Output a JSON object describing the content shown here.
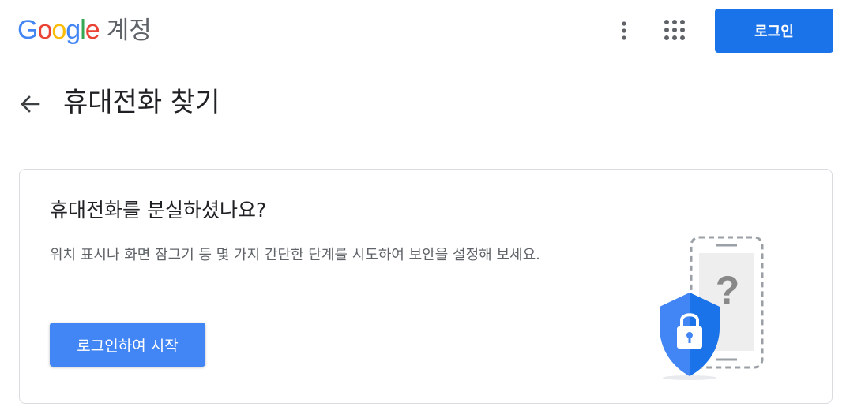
{
  "header": {
    "logo": {
      "letters": [
        {
          "char": "G",
          "color": "#4285F4"
        },
        {
          "char": "o",
          "color": "#EA4335"
        },
        {
          "char": "o",
          "color": "#FBBC05"
        },
        {
          "char": "g",
          "color": "#4285F4"
        },
        {
          "char": "l",
          "color": "#34A853"
        },
        {
          "char": "e",
          "color": "#EA4335"
        }
      ],
      "product": "계정"
    },
    "more_icon": "more-vertical-icon",
    "apps_icon": "apps-grid-icon",
    "signin_label": "로그인"
  },
  "page": {
    "back_icon": "arrow-back-icon",
    "title": "휴대전화 찾기"
  },
  "card": {
    "title": "휴대전화를 분실하셨나요?",
    "description": "위치 표시나 화면 잠그기 등 몇 가지 간단한 단계를 시도하여 보안을 설정해 보세요.",
    "cta_label": "로그인하여 시작",
    "illustration_icons": [
      "phone-outline-icon",
      "question-mark-icon",
      "shield-lock-icon"
    ]
  },
  "colors": {
    "primary": "#1a73e8",
    "cta": "#4285f4",
    "text": "#202124",
    "secondary_text": "#5f6368",
    "border": "#dadce0"
  }
}
